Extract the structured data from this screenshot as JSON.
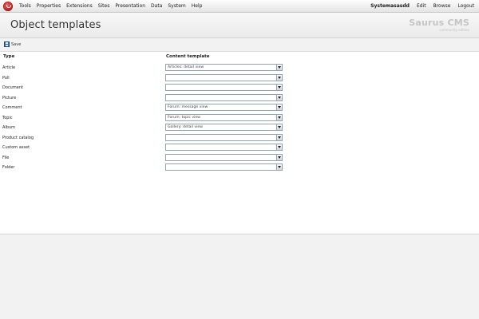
{
  "menubar": {
    "logo": "saurus-logo-icon",
    "left_items": [
      "Tools",
      "Properties",
      "Extensions",
      "Sites",
      "Presentation",
      "Data",
      "System",
      "Help"
    ],
    "user": "Systemasasdd",
    "right_items": [
      "Edit",
      "Browse",
      "Logout"
    ]
  },
  "header": {
    "title": "Object templates",
    "brand": "Saurus CMS",
    "brand_sub": "community edition"
  },
  "toolbar": {
    "save_label": "Save",
    "save_icon": "floppy-disk-icon"
  },
  "table": {
    "col_type": "Type",
    "col_template": "Content template",
    "rows": [
      {
        "label": "Article",
        "value": "Articles: detail view"
      },
      {
        "label": "Poll",
        "value": ""
      },
      {
        "label": "Document",
        "value": ""
      },
      {
        "label": "Picture",
        "value": ""
      },
      {
        "label": "Comment",
        "value": "Forum: message view"
      },
      {
        "label": "Topic",
        "value": "Forum: topic view"
      },
      {
        "label": "Album",
        "value": "Gallery: detail view"
      },
      {
        "label": "Product catalog",
        "value": ""
      },
      {
        "label": "Custom asset",
        "value": ""
      },
      {
        "label": "File",
        "value": ""
      },
      {
        "label": "Folder",
        "value": ""
      }
    ]
  }
}
